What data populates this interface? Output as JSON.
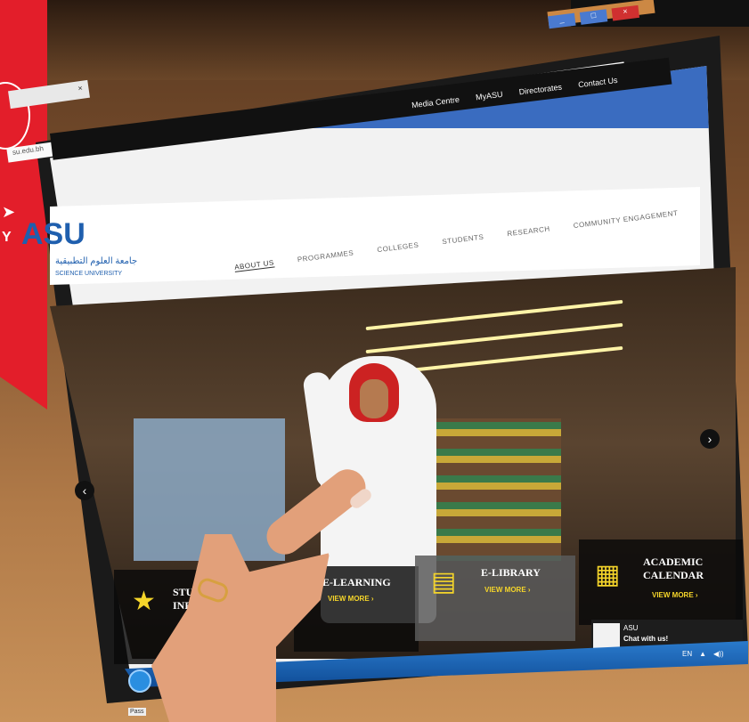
{
  "browser": {
    "tab_label": "",
    "tab_close": "×",
    "address": "su.edu.bh",
    "window_buttons": [
      "_",
      "□",
      "×"
    ]
  },
  "topnav": {
    "links": [
      "Media Centre",
      "MyASU",
      "Directorates",
      "Contact Us"
    ]
  },
  "logo": {
    "abbr": "ASU",
    "arabic": "جامعة العلوم التطبيقية",
    "english": "SCIENCE UNIVERSITY"
  },
  "mainnav": {
    "items": [
      "ABOUT US",
      "PROGRAMMES",
      "COLLEGES",
      "STUDENTS",
      "RESEARCH",
      "COMMUNITY ENGAGEMENT"
    ]
  },
  "hero": {
    "prev_arrow": "‹",
    "next_arrow": "›"
  },
  "tiles": [
    {
      "title": "STUDENT INFO",
      "more": "",
      "icon": "★"
    },
    {
      "title": "E-LEARNING",
      "more": "VIEW MORE ›",
      "icon": ""
    },
    {
      "title": "E-LIBRARY",
      "more": "VIEW MORE ›",
      "icon": "▤"
    },
    {
      "title": "ACADEMIC CALENDAR",
      "more": "VIEW MORE ›",
      "icon": "▦"
    }
  ],
  "chat": {
    "name": "ASU",
    "message": "Chat with us!"
  },
  "taskbar": {
    "lang": "EN",
    "tray_arrow": "▲",
    "volume": "◀))"
  },
  "misc": {
    "pass_label": "Pass"
  }
}
